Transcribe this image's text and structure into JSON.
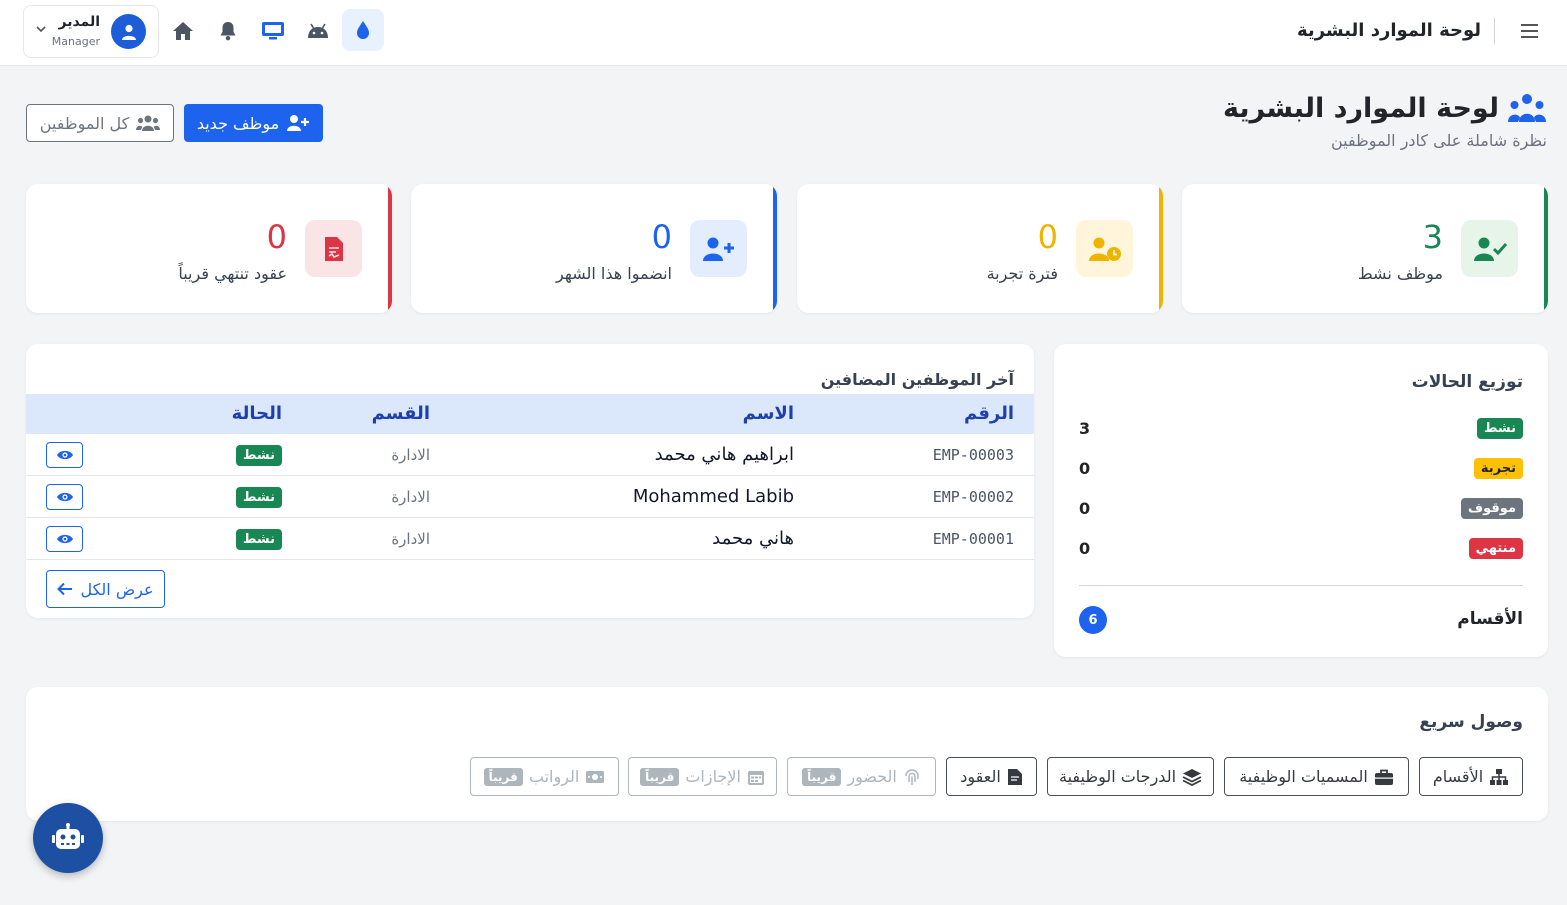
{
  "topbar": {
    "title": "لوحة الموارد البشرية",
    "user": {
      "name": "المدير",
      "role": "Manager"
    },
    "icons": [
      "home-icon",
      "bell-icon",
      "monitor-icon",
      "android-icon",
      "droplet-icon"
    ]
  },
  "header": {
    "title": "لوحة الموارد البشرية",
    "subtitle": "نظرة شاملة على كادر الموظفين",
    "new_employee_label": "موظف جديد",
    "all_employees_label": "كل الموظفين"
  },
  "stats": [
    {
      "value": "3",
      "label": "موظف نشط",
      "color": "#198754",
      "bg": "#e6f4ea",
      "icon": "user-check-icon"
    },
    {
      "value": "0",
      "label": "فترة تجربة",
      "color": "#f0b400",
      "bg": "#fff5db",
      "icon": "user-clock-icon"
    },
    {
      "value": "0",
      "label": "انضموا هذا الشهر",
      "color": "#1d63ed",
      "bg": "#e3edfd",
      "icon": "user-plus-icon"
    },
    {
      "value": "0",
      "label": "عقود تنتهي قريباً",
      "color": "#dc3545",
      "bg": "#fbe4e6",
      "icon": "file-contract-icon"
    }
  ],
  "recent": {
    "title": "آخر الموظفين المضافين",
    "columns": {
      "code": "الرقم",
      "name": "الاسم",
      "dept": "القسم",
      "status": "الحالة"
    },
    "rows": [
      {
        "code": "EMP-00003",
        "name": "ابراهيم هاني محمد",
        "dept": "الادارة",
        "status": "نشط"
      },
      {
        "code": "EMP-00002",
        "name": "Mohammed Labib",
        "dept": "الادارة",
        "status": "نشط"
      },
      {
        "code": "EMP-00001",
        "name": "هاني محمد",
        "dept": "الادارة",
        "status": "نشط"
      }
    ],
    "view_all_label": "عرض الكل"
  },
  "distribution": {
    "title": "توزيع الحالات",
    "items": [
      {
        "label": "نشط",
        "count": "3",
        "variant": "green"
      },
      {
        "label": "تجربة",
        "count": "0",
        "variant": "yellow"
      },
      {
        "label": "موقوف",
        "count": "0",
        "variant": "gray"
      },
      {
        "label": "منتهي",
        "count": "0",
        "variant": "red"
      }
    ],
    "departments_label": "الأقسام",
    "departments_count": "6"
  },
  "quick": {
    "title": "وصول سريع",
    "soon_label": "قريباً",
    "links": [
      {
        "label": "الأقسام",
        "icon": "sitemap-icon",
        "disabled": false
      },
      {
        "label": "المسميات الوظيفية",
        "icon": "briefcase-icon",
        "disabled": false
      },
      {
        "label": "الدرجات الوظيفية",
        "icon": "layers-icon",
        "disabled": false
      },
      {
        "label": "العقود",
        "icon": "file-contract-icon",
        "disabled": false
      },
      {
        "label": "الحضور",
        "icon": "fingerprint-icon",
        "disabled": true
      },
      {
        "label": "الإجازات",
        "icon": "calendar-icon",
        "disabled": true
      },
      {
        "label": "الرواتب",
        "icon": "money-icon",
        "disabled": true
      }
    ]
  }
}
